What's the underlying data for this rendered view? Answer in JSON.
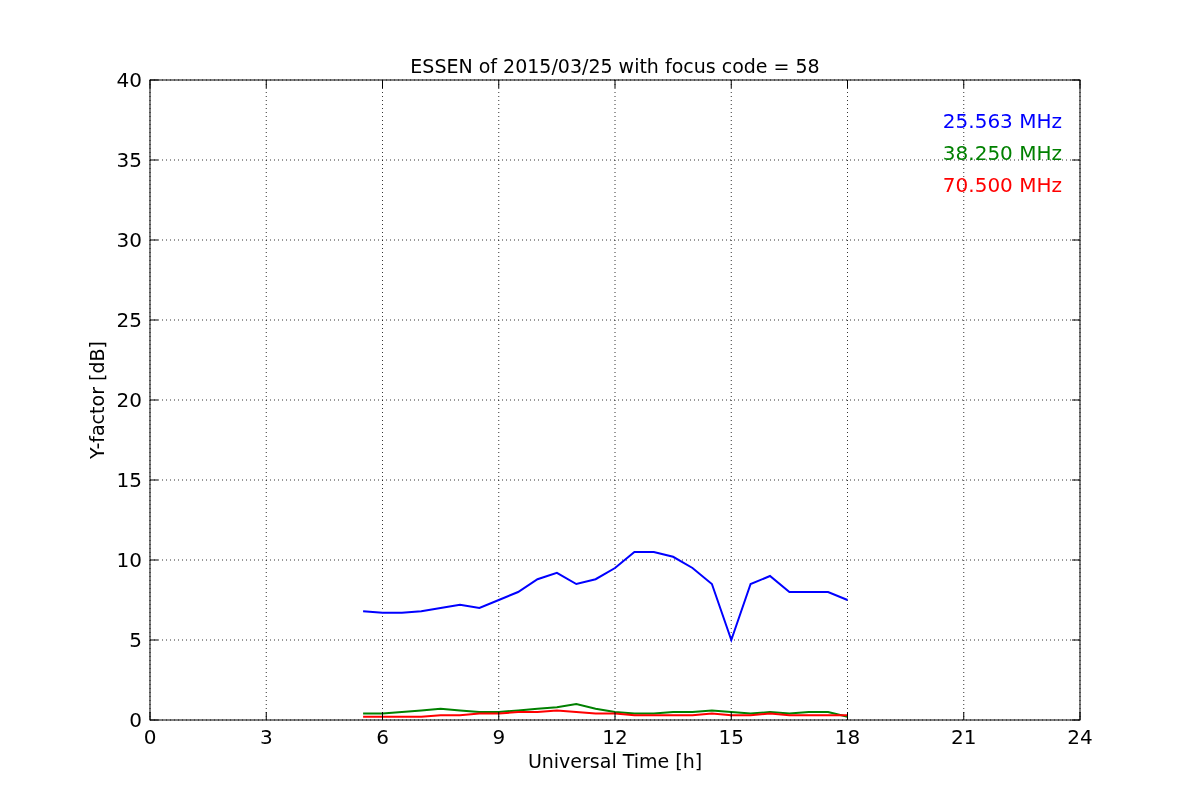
{
  "chart_data": {
    "type": "line",
    "title": "ESSEN of 2015/03/25 with focus code = 58",
    "xlabel": "Universal Time [h]",
    "ylabel": "Y-factor [dB]",
    "x": [
      5.5,
      6,
      6.5,
      7,
      7.5,
      8,
      8.5,
      9,
      9.5,
      10,
      10.5,
      11,
      11.5,
      12,
      12.5,
      13,
      13.5,
      14,
      14.5,
      15,
      15.5,
      16,
      16.5,
      17,
      17.5,
      18
    ],
    "series": [
      {
        "name": "25.563 MHz",
        "color": "#0000ff",
        "values": [
          6.8,
          6.7,
          6.7,
          6.8,
          7.0,
          7.2,
          7.0,
          7.5,
          8.0,
          8.8,
          9.2,
          8.5,
          8.8,
          9.5,
          10.5,
          10.5,
          10.2,
          9.5,
          8.5,
          5.0,
          8.5,
          9.0,
          8.0,
          8.0,
          8.0,
          7.5
        ]
      },
      {
        "name": "38.250 MHz",
        "color": "#008000",
        "values": [
          0.4,
          0.4,
          0.5,
          0.6,
          0.7,
          0.6,
          0.5,
          0.5,
          0.6,
          0.7,
          0.8,
          1.0,
          0.7,
          0.5,
          0.4,
          0.4,
          0.5,
          0.5,
          0.6,
          0.5,
          0.4,
          0.5,
          0.4,
          0.5,
          0.5,
          0.2
        ]
      },
      {
        "name": "70.500 MHz",
        "color": "#ff0000",
        "values": [
          0.2,
          0.2,
          0.2,
          0.2,
          0.3,
          0.3,
          0.4,
          0.4,
          0.5,
          0.5,
          0.6,
          0.5,
          0.4,
          0.4,
          0.3,
          0.3,
          0.3,
          0.3,
          0.4,
          0.3,
          0.3,
          0.4,
          0.3,
          0.3,
          0.3,
          0.3
        ]
      }
    ],
    "grid": true,
    "xlim": [
      0,
      24
    ],
    "ylim": [
      0,
      40
    ],
    "xticks": [
      0,
      3,
      6,
      9,
      12,
      15,
      18,
      21,
      24
    ],
    "yticks": [
      0,
      5,
      10,
      15,
      20,
      25,
      30,
      35,
      40
    ]
  }
}
